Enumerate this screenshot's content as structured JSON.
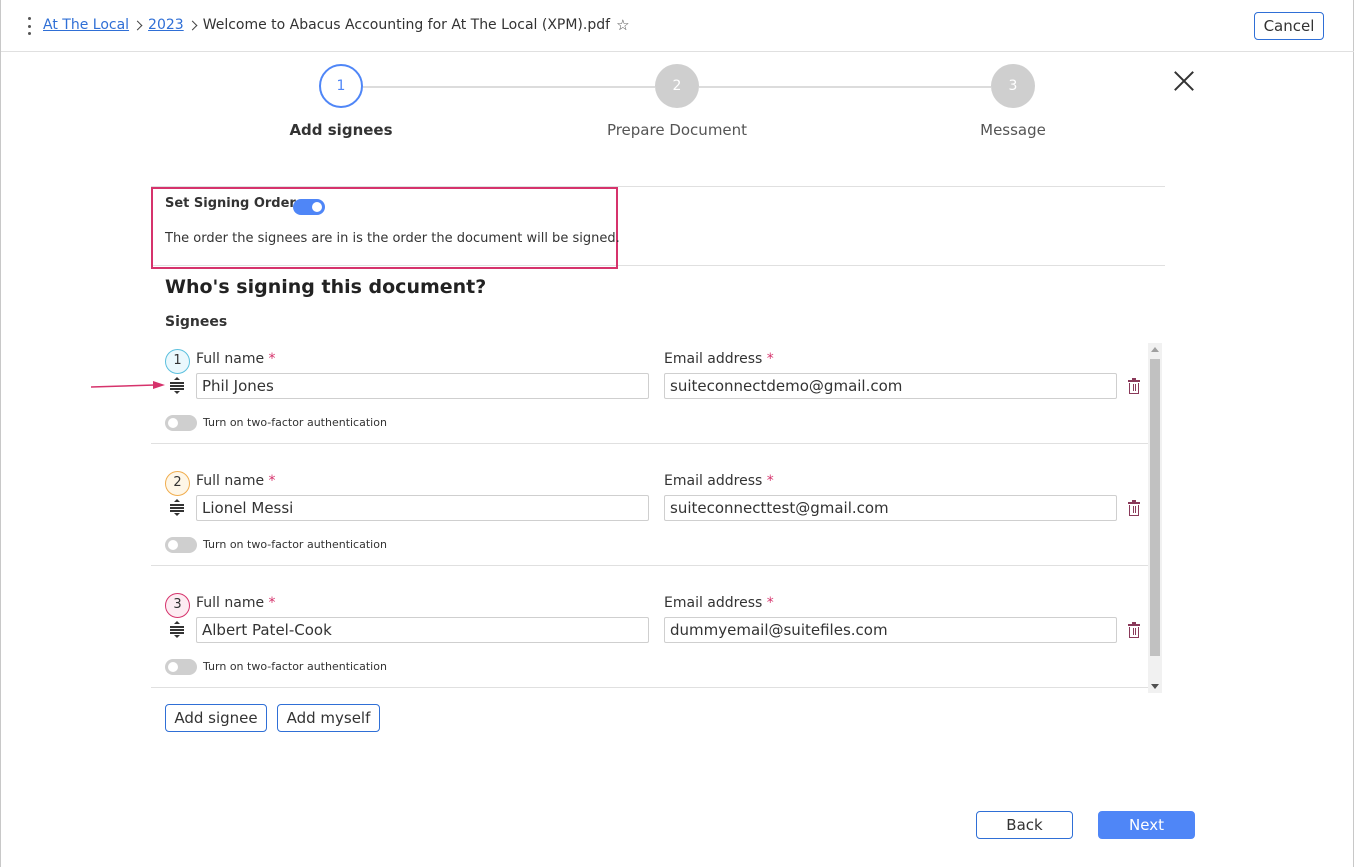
{
  "breadcrumb": {
    "items": [
      "At The Local",
      "2023"
    ],
    "file_name": "Welcome to Abacus Accounting for At The Local (XPM).pdf"
  },
  "header": {
    "cancel_label": "Cancel"
  },
  "steps": [
    {
      "number": "1",
      "label": "Add signees",
      "state": "active"
    },
    {
      "number": "2",
      "label": "Prepare Document",
      "state": "inactive"
    },
    {
      "number": "3",
      "label": "Message",
      "state": "inactive"
    }
  ],
  "signing_order": {
    "title": "Set Signing Order",
    "enabled": true,
    "description": "The order the signees are in is the order the document will be signed."
  },
  "form": {
    "heading": "Who's signing this document?",
    "subheading": "Signees",
    "full_name_label": "Full name",
    "email_label": "Email address",
    "required_marker": "*",
    "two_factor_label": "Turn on two-factor authentication"
  },
  "signees": [
    {
      "number": "1",
      "full_name": "Phil Jones",
      "email": "suiteconnectdemo@gmail.com",
      "two_factor": false,
      "badge_color": "#5bc0de"
    },
    {
      "number": "2",
      "full_name": "Lionel Messi",
      "email": "suiteconnecttest@gmail.com",
      "two_factor": false,
      "badge_color": "#f0ad4e"
    },
    {
      "number": "3",
      "full_name": "Albert Patel-Cook",
      "email": "dummyemail@suitefiles.com",
      "two_factor": false,
      "badge_color": "#d6336c"
    }
  ],
  "actions": {
    "add_signee_label": "Add signee",
    "add_myself_label": "Add myself",
    "back_label": "Back",
    "next_label": "Next"
  },
  "colors": {
    "accent": "#4f86f7",
    "link": "#2f6fd6",
    "highlight_border": "#d6336c"
  }
}
